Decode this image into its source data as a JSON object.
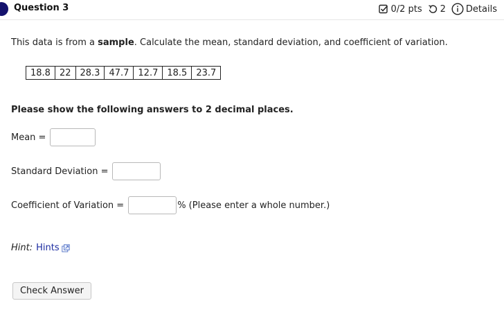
{
  "header": {
    "question_title": "Question 3",
    "score": "0/2 pts",
    "attempts": "2",
    "details_label": "Details"
  },
  "prompt": {
    "lead": "This data is from a ",
    "emphasis": "sample",
    "tail": ". Calculate the mean, standard deviation, and coefficient of variation."
  },
  "data_values": [
    "18.8",
    "22",
    "28.3",
    "47.7",
    "12.7",
    "18.5",
    "23.7"
  ],
  "instructions": "Please show the following answers to 2 decimal places.",
  "fields": {
    "mean_label": "Mean =",
    "std_label": "Standard Deviation =",
    "cv_label": "Coefficient of Variation =",
    "cv_suffix": "% (Please enter a whole number.)"
  },
  "hint": {
    "label": "Hint:",
    "link": "Hints"
  },
  "check_button": "Check Answer",
  "colors": {
    "accent_dot": "#14126d",
    "link": "#1a2aa0"
  }
}
